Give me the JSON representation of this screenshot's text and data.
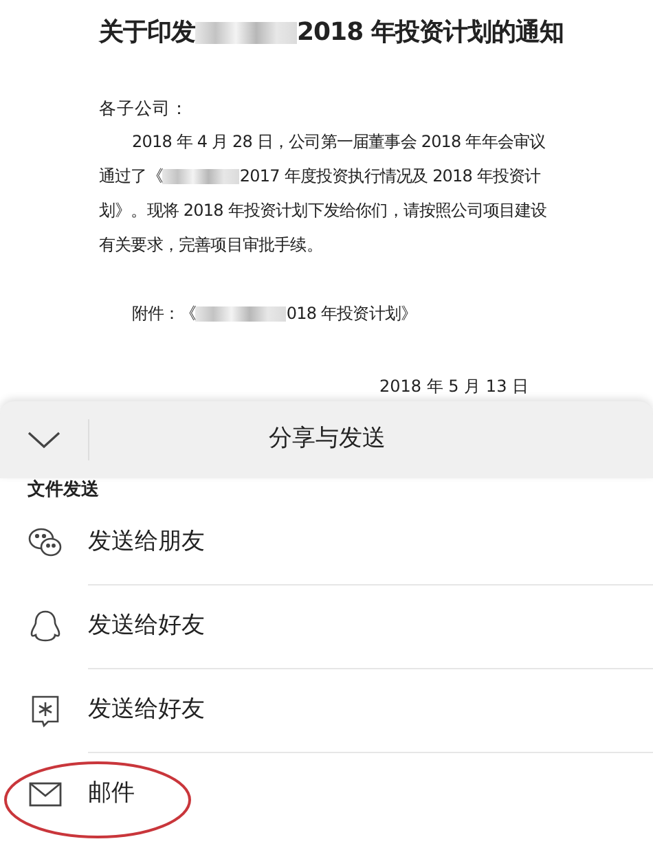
{
  "document": {
    "title": [
      {
        "kind": "text",
        "text": "关于印发"
      },
      {
        "kind": "redacted"
      },
      {
        "kind": "text",
        "text": "2018 年投资计划的通知"
      }
    ],
    "salutation": "各子公司：",
    "paragraph": [
      {
        "kind": "text",
        "text": "2018 年 4 月 28 日，公司第一届董事会 2018 年年会审议通过了《"
      },
      {
        "kind": "redacted"
      },
      {
        "kind": "text",
        "text": "2017 年度投资执行情况及 2018 年投资计划》。现将 2018 年投资计划下发给你们，请按照公司项目建设有关要求，完善项目审批手续。"
      }
    ],
    "attachment": [
      {
        "kind": "text",
        "text": "附件：《"
      },
      {
        "kind": "redacted"
      },
      {
        "kind": "text",
        "text": "018 年投资计划》"
      }
    ],
    "date": "2018 年 5 月 13 日"
  },
  "sheet": {
    "title": "分享与发送",
    "section": "文件发送",
    "items": [
      {
        "kind": "chat",
        "label": "发送给朋友",
        "highlighted": false
      },
      {
        "kind": "penguin",
        "label": "发送给好友",
        "highlighted": false
      },
      {
        "kind": "star",
        "label": "发送给好友",
        "highlighted": false
      },
      {
        "kind": "mail",
        "label": "邮件",
        "highlighted": true
      }
    ]
  }
}
